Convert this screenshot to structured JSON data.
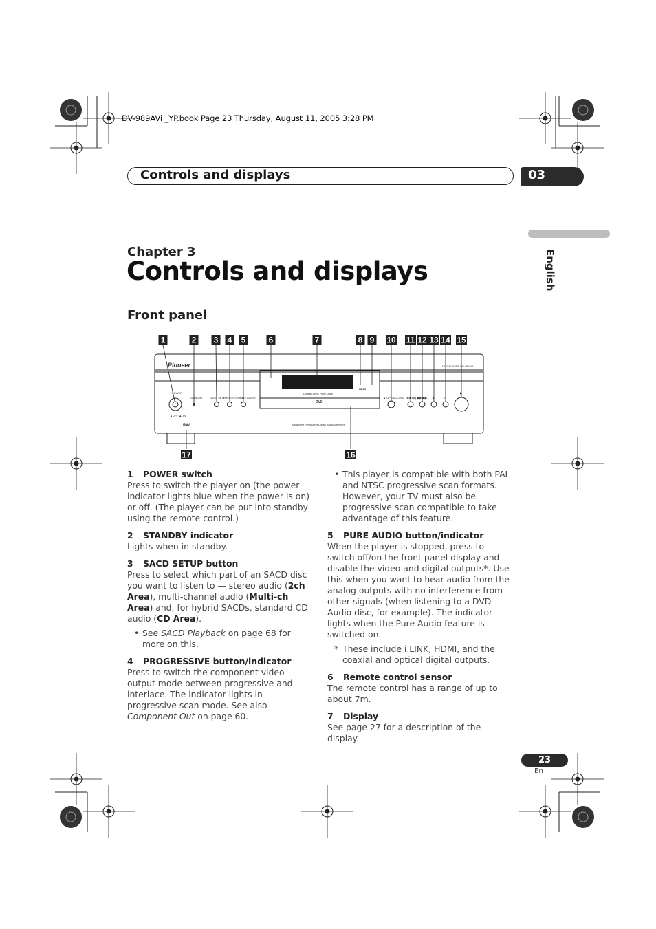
{
  "book_info": "DV-989AVi _YP.book  Page 23  Thursday, August 11, 2005  3:28 PM",
  "header": {
    "title": "Controls and displays",
    "chapter_number": "03"
  },
  "language_tab": "English",
  "chapter_label": "Chapter 3",
  "page_title": "Controls and displays",
  "section_title": "Front panel",
  "diagram": {
    "callouts": [
      "1",
      "2",
      "3",
      "4",
      "5",
      "6",
      "7",
      "8",
      "9",
      "10",
      "11",
      "12",
      "13",
      "14",
      "15",
      "16",
      "17"
    ],
    "brand": "Pioneer",
    "model": "DVD PLAYER  DV-989AVi",
    "labels": {
      "power": "POWER",
      "standby": "STANDBY",
      "sacd_setup": "SACD SETUP",
      "progressive": "PROGRESSIVE",
      "pure_audio": "PURE AUDIO",
      "off_on": "▲OFF ▲ON",
      "display_caption": "Digital Direct Pixel Drive",
      "hdmi": "HDMI",
      "dvd": "DVD",
      "open_close": "▲ OPEN/CLOSE",
      "prev": "I◀◀ ◀◀",
      "next": "▶▶ ▶▶I",
      "stop": "■",
      "pause": "II",
      "play": "▶",
      "interface": "Advanced Resolution Digital Audio Interface",
      "rw": "RW"
    }
  },
  "left_column": {
    "item1": {
      "num": "1",
      "title": "POWER switch",
      "body": "Press to switch the player on (the power indicator lights blue when the power is on) or off. (The player can be put into standby using the remote control.)"
    },
    "item2": {
      "num": "2",
      "title": "STANDBY indicator",
      "body": "Lights when in standby."
    },
    "item3": {
      "num": "3",
      "title": "SACD SETUP button",
      "body_parts": [
        "Press to select which part of an SACD disc you want to listen to — stereo audio (",
        "2ch Area",
        "), multi-channel audio (",
        "Multi-ch Area",
        ") and, for hybrid SACDs, standard CD audio (",
        "CD Area",
        ")."
      ],
      "bullet_parts": [
        "See ",
        "SACD Playback",
        " on page 68 for more on this."
      ]
    },
    "item4": {
      "num": "4",
      "title": "PROGRESSIVE button/indicator",
      "body_parts": [
        "Press to switch the component video output mode between progressive and interlace. The indicator lights in progressive scan mode. See also ",
        "Component Out",
        " on page 60."
      ]
    }
  },
  "right_column": {
    "bullet": "This player is compatible with both PAL and NTSC progressive scan formats. However, your TV must also be progressive scan compatible to take advantage of this feature.",
    "item5": {
      "num": "5",
      "title": "PURE AUDIO button/indicator",
      "body": "When the player is stopped, press to switch off/on the front panel display and disable the video and digital outputs*. Use this when you want to hear audio from the analog outputs with no interference from other signals (when listening to a DVD-Audio disc, for example). The indicator lights when the Pure Audio feature is switched on.",
      "note": "These include i.LINK, HDMI, and the coaxial and optical digital outputs."
    },
    "item6": {
      "num": "6",
      "title": "Remote control sensor",
      "body": "The remote control has a range of up to about 7m."
    },
    "item7": {
      "num": "7",
      "title": "Display",
      "body": "See page 27 for a description of the display."
    }
  },
  "footer": {
    "page_number": "23",
    "lang_code": "En"
  }
}
